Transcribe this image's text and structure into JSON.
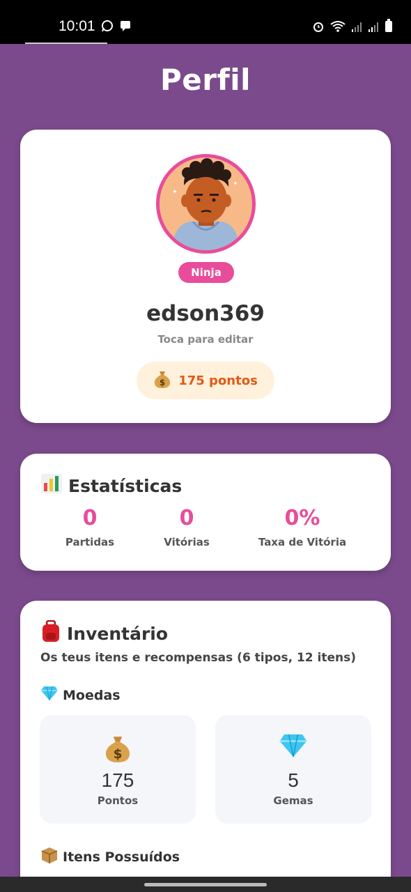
{
  "status_bar": {
    "time": "10:01",
    "left_icons": [
      "whatsapp-icon",
      "message-icon"
    ],
    "right_icons": [
      "alarm-icon",
      "wifi-icon",
      "signal-icon",
      "signal-icon",
      "battery-icon"
    ]
  },
  "header": {
    "title": "Perfil"
  },
  "profile": {
    "badge": "Ninja",
    "username": "edson369",
    "edit_hint": "Toca para editar",
    "points_label": "175 pontos",
    "points_icon": "money-bag-icon"
  },
  "stats": {
    "title": "Estatísticas",
    "icon": "bar-chart-icon",
    "items": [
      {
        "value": "0",
        "label": "Partidas"
      },
      {
        "value": "0",
        "label": "Vitórias"
      },
      {
        "value": "0%",
        "label": "Taxa de Vitória"
      }
    ]
  },
  "inventory": {
    "title": "Inventário",
    "icon": "backpack-icon",
    "subtitle": "Os teus itens e recompensas (6 tipos, 12 itens)",
    "currencies_title": "Moedas",
    "currencies_icon": "gem-icon",
    "currencies": [
      {
        "icon": "money-bag-icon",
        "value": "175",
        "label": "Pontos"
      },
      {
        "icon": "gem-icon",
        "value": "5",
        "label": "Gemas"
      }
    ],
    "items_title": "Itens Possuídos",
    "items_icon": "package-icon"
  },
  "colors": {
    "background": "#7b4a8c",
    "accent": "#e84c9b",
    "points_text": "#e05a16",
    "points_pill": "#fff1db"
  }
}
